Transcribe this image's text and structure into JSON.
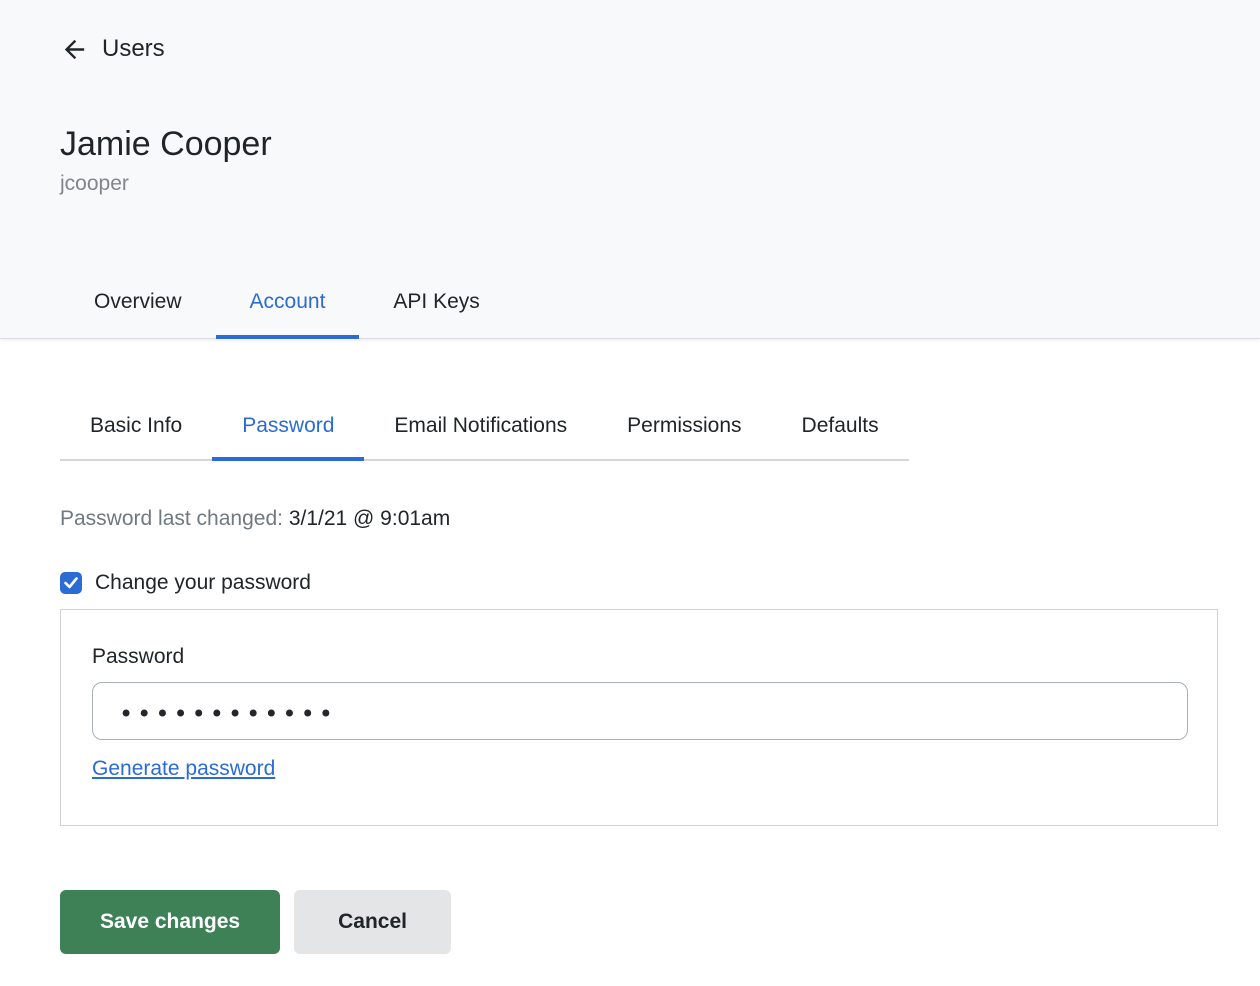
{
  "header": {
    "back_label": "Users",
    "user_name": "Jamie Cooper",
    "username": "jcooper",
    "tabs": [
      {
        "label": "Overview",
        "active": false
      },
      {
        "label": "Account",
        "active": true
      },
      {
        "label": "API Keys",
        "active": false
      }
    ]
  },
  "subtabs": [
    {
      "label": "Basic Info",
      "active": false
    },
    {
      "label": "Password",
      "active": true
    },
    {
      "label": "Email Notifications",
      "active": false
    },
    {
      "label": "Permissions",
      "active": false
    },
    {
      "label": "Defaults",
      "active": false
    }
  ],
  "password_section": {
    "last_changed_label": "Password last changed:",
    "last_changed_value": "3/1/21 @ 9:01am",
    "change_checkbox_label": "Change your password",
    "change_checkbox_checked": true,
    "field_label": "Password",
    "field_value_masked": "••••••••••••",
    "generate_link_label": "Generate password"
  },
  "actions": {
    "save_label": "Save changes",
    "cancel_label": "Cancel"
  },
  "colors": {
    "accent_blue": "#2a6cd4",
    "save_green": "#3e8157",
    "cancel_gray": "#e3e5e7",
    "header_background": "#f8f9fa",
    "muted_text": "#6f7980"
  }
}
